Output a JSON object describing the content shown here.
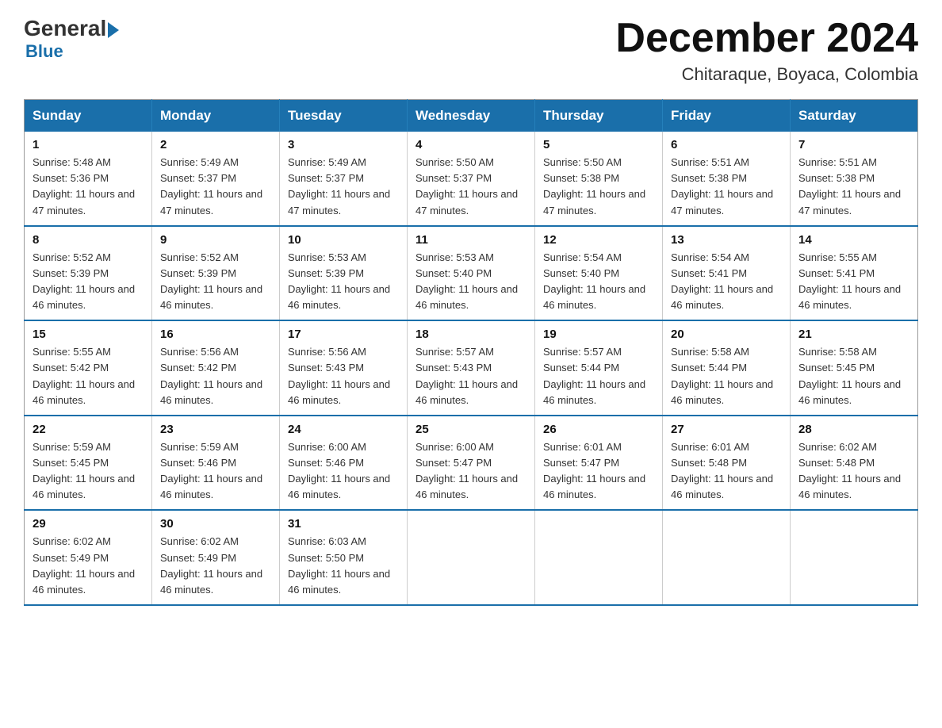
{
  "logo": {
    "general": "General",
    "blue": "Blue"
  },
  "title": {
    "month": "December 2024",
    "location": "Chitaraque, Boyaca, Colombia"
  },
  "days_of_week": [
    "Sunday",
    "Monday",
    "Tuesday",
    "Wednesday",
    "Thursday",
    "Friday",
    "Saturday"
  ],
  "weeks": [
    [
      {
        "day": "1",
        "sunrise": "5:48 AM",
        "sunset": "5:36 PM",
        "daylight": "11 hours and 47 minutes."
      },
      {
        "day": "2",
        "sunrise": "5:49 AM",
        "sunset": "5:37 PM",
        "daylight": "11 hours and 47 minutes."
      },
      {
        "day": "3",
        "sunrise": "5:49 AM",
        "sunset": "5:37 PM",
        "daylight": "11 hours and 47 minutes."
      },
      {
        "day": "4",
        "sunrise": "5:50 AM",
        "sunset": "5:37 PM",
        "daylight": "11 hours and 47 minutes."
      },
      {
        "day": "5",
        "sunrise": "5:50 AM",
        "sunset": "5:38 PM",
        "daylight": "11 hours and 47 minutes."
      },
      {
        "day": "6",
        "sunrise": "5:51 AM",
        "sunset": "5:38 PM",
        "daylight": "11 hours and 47 minutes."
      },
      {
        "day": "7",
        "sunrise": "5:51 AM",
        "sunset": "5:38 PM",
        "daylight": "11 hours and 47 minutes."
      }
    ],
    [
      {
        "day": "8",
        "sunrise": "5:52 AM",
        "sunset": "5:39 PM",
        "daylight": "11 hours and 46 minutes."
      },
      {
        "day": "9",
        "sunrise": "5:52 AM",
        "sunset": "5:39 PM",
        "daylight": "11 hours and 46 minutes."
      },
      {
        "day": "10",
        "sunrise": "5:53 AM",
        "sunset": "5:39 PM",
        "daylight": "11 hours and 46 minutes."
      },
      {
        "day": "11",
        "sunrise": "5:53 AM",
        "sunset": "5:40 PM",
        "daylight": "11 hours and 46 minutes."
      },
      {
        "day": "12",
        "sunrise": "5:54 AM",
        "sunset": "5:40 PM",
        "daylight": "11 hours and 46 minutes."
      },
      {
        "day": "13",
        "sunrise": "5:54 AM",
        "sunset": "5:41 PM",
        "daylight": "11 hours and 46 minutes."
      },
      {
        "day": "14",
        "sunrise": "5:55 AM",
        "sunset": "5:41 PM",
        "daylight": "11 hours and 46 minutes."
      }
    ],
    [
      {
        "day": "15",
        "sunrise": "5:55 AM",
        "sunset": "5:42 PM",
        "daylight": "11 hours and 46 minutes."
      },
      {
        "day": "16",
        "sunrise": "5:56 AM",
        "sunset": "5:42 PM",
        "daylight": "11 hours and 46 minutes."
      },
      {
        "day": "17",
        "sunrise": "5:56 AM",
        "sunset": "5:43 PM",
        "daylight": "11 hours and 46 minutes."
      },
      {
        "day": "18",
        "sunrise": "5:57 AM",
        "sunset": "5:43 PM",
        "daylight": "11 hours and 46 minutes."
      },
      {
        "day": "19",
        "sunrise": "5:57 AM",
        "sunset": "5:44 PM",
        "daylight": "11 hours and 46 minutes."
      },
      {
        "day": "20",
        "sunrise": "5:58 AM",
        "sunset": "5:44 PM",
        "daylight": "11 hours and 46 minutes."
      },
      {
        "day": "21",
        "sunrise": "5:58 AM",
        "sunset": "5:45 PM",
        "daylight": "11 hours and 46 minutes."
      }
    ],
    [
      {
        "day": "22",
        "sunrise": "5:59 AM",
        "sunset": "5:45 PM",
        "daylight": "11 hours and 46 minutes."
      },
      {
        "day": "23",
        "sunrise": "5:59 AM",
        "sunset": "5:46 PM",
        "daylight": "11 hours and 46 minutes."
      },
      {
        "day": "24",
        "sunrise": "6:00 AM",
        "sunset": "5:46 PM",
        "daylight": "11 hours and 46 minutes."
      },
      {
        "day": "25",
        "sunrise": "6:00 AM",
        "sunset": "5:47 PM",
        "daylight": "11 hours and 46 minutes."
      },
      {
        "day": "26",
        "sunrise": "6:01 AM",
        "sunset": "5:47 PM",
        "daylight": "11 hours and 46 minutes."
      },
      {
        "day": "27",
        "sunrise": "6:01 AM",
        "sunset": "5:48 PM",
        "daylight": "11 hours and 46 minutes."
      },
      {
        "day": "28",
        "sunrise": "6:02 AM",
        "sunset": "5:48 PM",
        "daylight": "11 hours and 46 minutes."
      }
    ],
    [
      {
        "day": "29",
        "sunrise": "6:02 AM",
        "sunset": "5:49 PM",
        "daylight": "11 hours and 46 minutes."
      },
      {
        "day": "30",
        "sunrise": "6:02 AM",
        "sunset": "5:49 PM",
        "daylight": "11 hours and 46 minutes."
      },
      {
        "day": "31",
        "sunrise": "6:03 AM",
        "sunset": "5:50 PM",
        "daylight": "11 hours and 46 minutes."
      },
      null,
      null,
      null,
      null
    ]
  ]
}
